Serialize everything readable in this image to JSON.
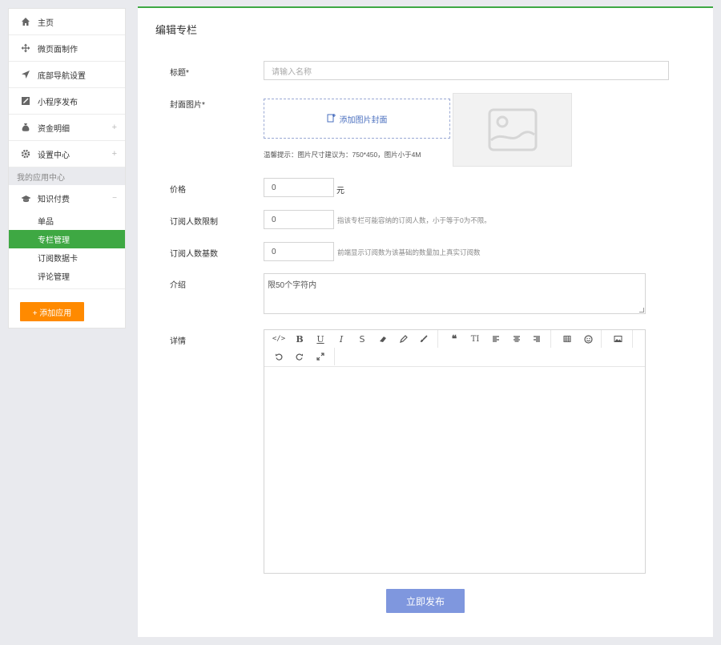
{
  "sidebar": {
    "menu": [
      {
        "label": "主页",
        "icon": "home-icon"
      },
      {
        "label": "微页面制作",
        "icon": "move-icon"
      },
      {
        "label": "底部导航设置",
        "icon": "navigation-icon"
      },
      {
        "label": "小程序发布",
        "icon": "edit-icon"
      },
      {
        "label": "资金明细",
        "icon": "money-bag-icon",
        "expand": "+"
      },
      {
        "label": "设置中心",
        "icon": "gear-icon",
        "expand": "+"
      }
    ],
    "section_title": "我的应用中心",
    "group": {
      "label": "知识付费",
      "icon": "graduation-cap-icon",
      "collapse": "−"
    },
    "sub_items": [
      "单品",
      "专栏管理",
      "订阅数据卡",
      "评论管理"
    ],
    "add_app_label": "+ 添加应用"
  },
  "main": {
    "title": "编辑专栏",
    "form": {
      "title_label": "标题*",
      "title_placeholder": "请输入名称",
      "cover_label": "封面图片*",
      "upload_label": "添加图片封面",
      "cover_hint": "温馨提示：图片尺寸建议为：750*450，图片小于4M",
      "price_label": "价格",
      "price_value": "0",
      "price_unit": "元",
      "subscriber_limit_label": "订阅人数限制",
      "subscriber_limit_value": "0",
      "subscriber_limit_hint": "指该专栏可能容纳的订阅人数，小于等于0为不限。",
      "subscriber_base_label": "订阅人数基数",
      "subscriber_base_value": "0",
      "subscriber_base_hint": "前端显示订阅数为该基础的数量加上真实订阅数",
      "intro_label": "介绍",
      "intro_placeholder": "限50个字符内",
      "detail_label": "详情"
    },
    "toolbar_icons": [
      "code-icon",
      "bold-icon",
      "underline-icon",
      "italic-icon",
      "strikethrough-icon",
      "eraser-icon",
      "pen-icon",
      "brush-icon",
      "quote-icon",
      "text-size-icon",
      "align-left-icon",
      "align-center-icon",
      "align-right-icon",
      "table-icon",
      "emoji-icon",
      "image-icon",
      "undo-icon",
      "redo-icon",
      "fullscreen-icon"
    ],
    "toolbar_glyphs": {
      "bold": "B",
      "underline": "U",
      "italic": "I",
      "strike": "S",
      "quote": "❝",
      "text_size": "TI"
    },
    "publish_label": "立即发布"
  },
  "colors": {
    "accent_green": "#3ea843",
    "orange": "#ff8a00",
    "publish_blue": "#7f97de",
    "link_blue": "#4a6fbf"
  }
}
